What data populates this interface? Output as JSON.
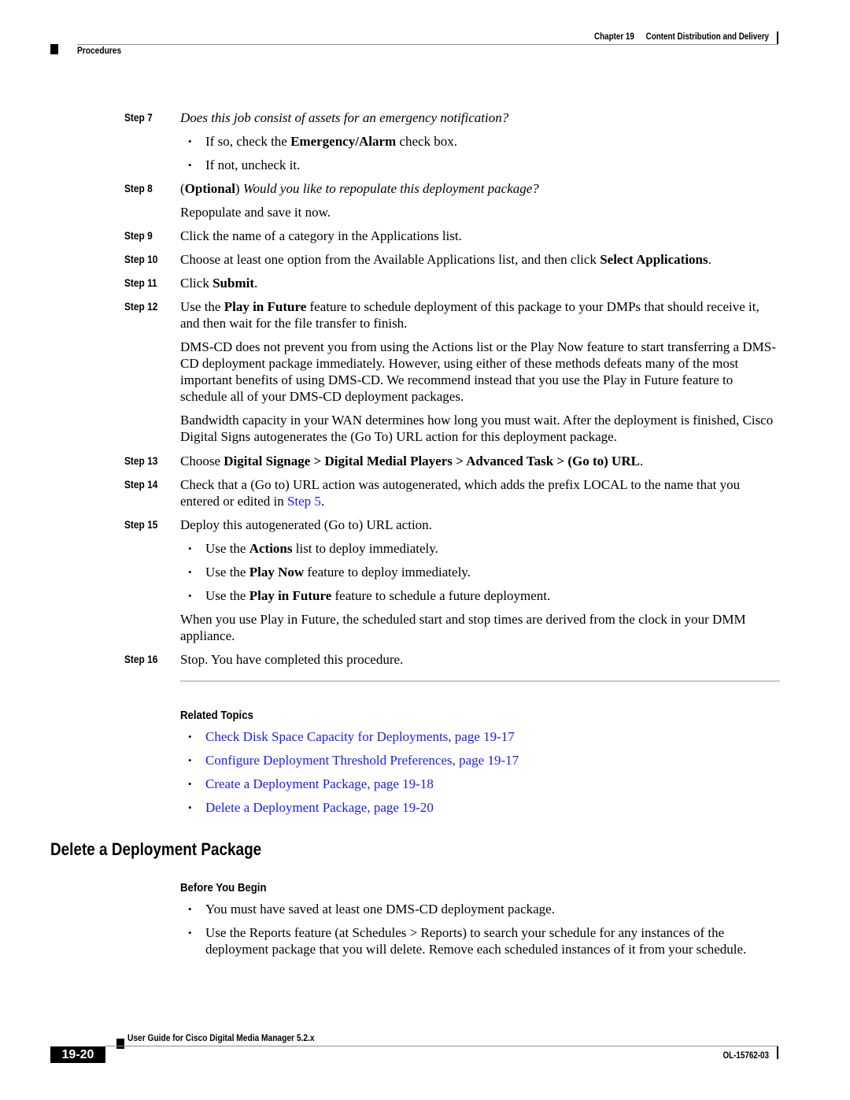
{
  "header": {
    "chapter": "Chapter 19",
    "chapter_title": "Content Distribution and Delivery",
    "section": "Procedures"
  },
  "steps": [
    {
      "label": "Step 7",
      "question": "Does this job consist of assets for an emergency notification?",
      "bullets": [
        {
          "pre": "If so, check the ",
          "bold": "Emergency/Alarm",
          "post": " check box."
        },
        {
          "text": "If not, uncheck it."
        }
      ]
    },
    {
      "label": "Step 8",
      "optional": "Optional",
      "question": "Would you like to repopulate this deployment package?",
      "body": "Repopulate and save it now."
    },
    {
      "label": "Step 9",
      "text": "Click the name of a category in the Applications list."
    },
    {
      "label": "Step 10",
      "pre": "Choose at least one option from the Available Applications list, and then click ",
      "bold": "Select Applications",
      "post": "."
    },
    {
      "label": "Step 11",
      "pre": "Click ",
      "bold": "Submit",
      "post": "."
    },
    {
      "label": "Step 12",
      "pre": "Use the ",
      "bold": "Play in Future",
      "post": " feature to schedule deployment of this package to your DMPs that should receive it, and then wait for the file transfer to finish.",
      "paragraphs": [
        "DMS-CD does not prevent you from using the Actions list or the Play Now feature to start transferring a DMS-CD deployment package immediately. However, using either of these methods defeats many of the most important benefits of using DMS-CD. We recommend instead that you use the Play in Future feature to schedule all of your DMS-CD deployment packages.",
        "Bandwidth capacity in your WAN determines how long you must wait. After the deployment is finished, Cisco Digital Signs autogenerates the (Go To) URL action for this deployment package."
      ]
    },
    {
      "label": "Step 13",
      "pre": "Choose ",
      "bold": "Digital Signage > Digital Medial Players > Advanced Task > (Go to) URL",
      "post": "."
    },
    {
      "label": "Step 14",
      "pre": "Check that a (Go to) URL action was autogenerated, which adds the prefix LOCAL to the name that you entered or edited in ",
      "link": "Step 5",
      "post": "."
    },
    {
      "label": "Step 15",
      "text": "Deploy this autogenerated (Go to) URL action.",
      "bullets": [
        {
          "pre": "Use the ",
          "bold": "Actions",
          "post": " list to deploy immediately."
        },
        {
          "pre": "Use the ",
          "bold": "Play Now",
          "post": " feature to deploy immediately."
        },
        {
          "pre": "Use the ",
          "bold": "Play in Future",
          "post": " feature to schedule a future deployment."
        }
      ],
      "note": "When you use Play in Future, the scheduled start and stop times are derived from the clock in your DMM appliance."
    },
    {
      "label": "Step 16",
      "text": "Stop. You have completed this procedure."
    }
  ],
  "related_topics": {
    "heading": "Related Topics",
    "links": [
      "Check Disk Space Capacity for Deployments, page 19-17",
      "Configure Deployment Threshold Preferences, page 19-17",
      "Create a Deployment Package, page 19-18",
      "Delete a Deployment Package, page 19-20"
    ]
  },
  "section": {
    "title": "Delete a Deployment Package",
    "before_heading": "Before You Begin",
    "bullets": [
      "You must have saved at least one DMS-CD deployment package.",
      "Use the Reports feature (at Schedules > Reports) to search your schedule for any instances of the deployment package that you will delete. Remove each scheduled instances of it from your schedule."
    ]
  },
  "footer": {
    "guide_title": "User Guide for Cisco Digital Media Manager 5.2.x",
    "page_number": "19-20",
    "doc_id": "OL-15762-03"
  },
  "colors": {
    "link": "#1a1aff",
    "rule": "#8c8c8c"
  },
  "bullet_glyph": "•"
}
